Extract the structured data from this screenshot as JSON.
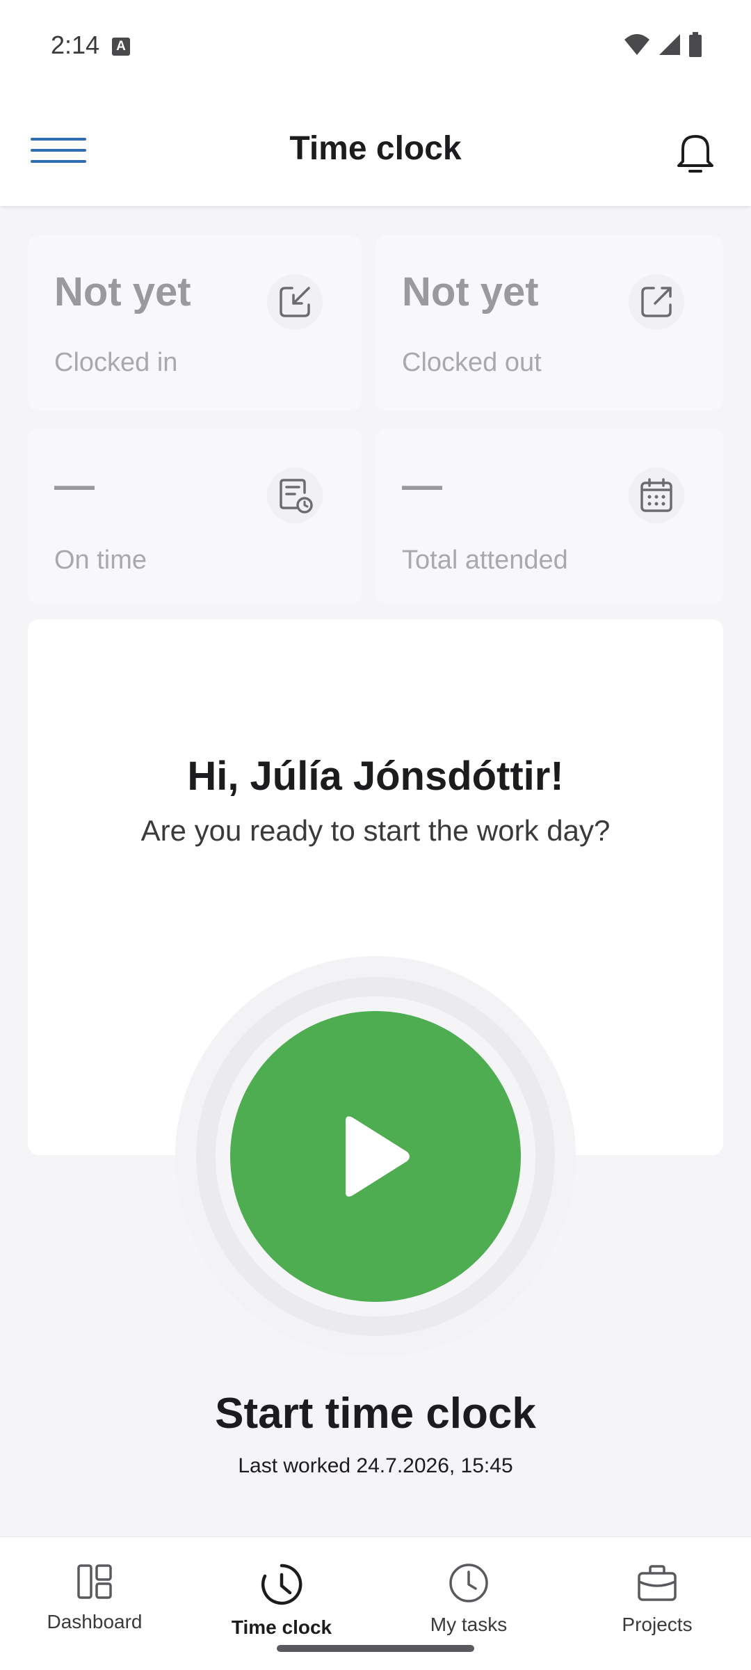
{
  "status_bar": {
    "time": "2:14",
    "badge": "A"
  },
  "app_bar": {
    "title": "Time clock"
  },
  "stats": {
    "clocked_in": {
      "value": "Not yet",
      "label": "Clocked in"
    },
    "clocked_out": {
      "value": "Not yet",
      "label": "Clocked out"
    },
    "on_time": {
      "value": "—",
      "label": "On time"
    },
    "total_attended": {
      "value": "—",
      "label": "Total attended"
    }
  },
  "welcome": {
    "greeting": "Hi, Júlía Jónsdóttir!",
    "question": "Are you ready to start the work day?"
  },
  "timer": {
    "title": "Start time clock",
    "last_worked": "Last worked 24.7.2026, 15:45"
  },
  "nav": {
    "items": [
      {
        "label": "Dashboard",
        "icon": "dashboard-icon"
      },
      {
        "label": "Time clock",
        "icon": "time-clock-icon",
        "active": true
      },
      {
        "label": "My tasks",
        "icon": "clock-icon"
      },
      {
        "label": "Projects",
        "icon": "briefcase-icon"
      }
    ]
  },
  "colors": {
    "accent": "#2f6db5",
    "start_green": "#4fad51"
  }
}
